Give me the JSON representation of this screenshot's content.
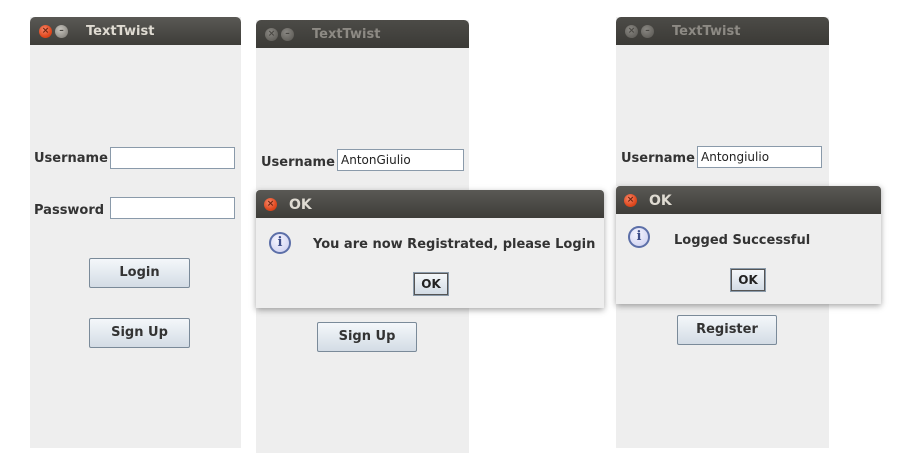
{
  "window1": {
    "title": "TextTwist",
    "username_label": "Username",
    "username_value": "",
    "password_label": "Password",
    "password_value": "",
    "login_button": "Login",
    "signup_button": "Sign Up"
  },
  "window2": {
    "title": "TextTwist",
    "username_label": "Username",
    "username_value": "AntonGiulio",
    "signup_button": "Sign Up",
    "dialog": {
      "title": "OK",
      "message": "You are now Registrated, please Login",
      "ok_button": "OK"
    }
  },
  "window3": {
    "title": "TextTwist",
    "username_label": "Username",
    "username_value": "Antongiulio",
    "register_button": "Register",
    "dialog": {
      "title": "OK",
      "message": "Logged Successful",
      "ok_button": "OK"
    }
  },
  "icons": {
    "close": "×",
    "minimize": "–",
    "info": "i"
  }
}
